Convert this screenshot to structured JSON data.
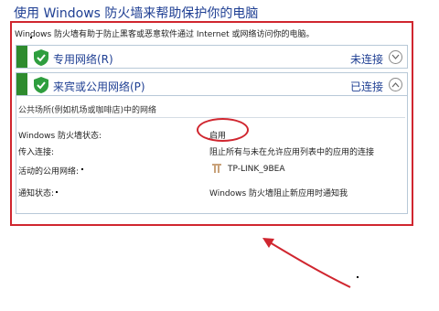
{
  "page_title": "使用 Windows 防火墙来帮助保护你的电脑",
  "description": "Windows 防火墙有助于防止黑客或恶意软件通过 Internet 或网络访问你的电脑。",
  "networks": [
    {
      "name": "专用网络(R)",
      "status": "未连接",
      "expanded": false
    },
    {
      "name": "来宾或公用网络(P)",
      "status": "已连接",
      "expanded": true
    }
  ],
  "public_network": {
    "description": "公共场所(例如机场或咖啡店)中的网络",
    "rows": [
      {
        "label": "Windows 防火墙状态:",
        "value": "启用"
      },
      {
        "label": "传入连接:",
        "value": "阻止所有与未在允许应用列表中的应用的连接"
      },
      {
        "label": "活动的公用网络:",
        "value": "TP-LINK_9BEA"
      },
      {
        "label": "通知状态:",
        "value": "Windows 防火墙阻止新应用时通知我"
      }
    ]
  },
  "colors": {
    "heading": "#1f3f93",
    "status_stripe": "#2e8b2e",
    "shield": "#2e9e3e",
    "annotation": "#d0262f"
  },
  "icons": [
    "shield-check-icon",
    "chevron-down-icon",
    "chevron-up-icon",
    "wifi-icon"
  ]
}
